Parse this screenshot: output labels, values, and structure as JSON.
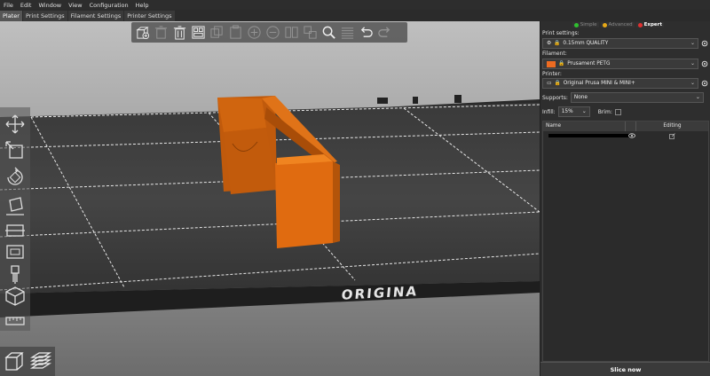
{
  "menu": [
    "File",
    "Edit",
    "Window",
    "View",
    "Configuration",
    "Help"
  ],
  "tabs": [
    "Plater",
    "Print Settings",
    "Filament Settings",
    "Printer Settings"
  ],
  "viewport": {
    "bed_text": "ORIGINA"
  },
  "top_toolbar": [
    {
      "icon": "add-icon",
      "enabled": true
    },
    {
      "icon": "delete-icon",
      "enabled": false
    },
    {
      "icon": "delete-all-icon",
      "enabled": true
    },
    {
      "icon": "arrange-icon",
      "enabled": true
    },
    {
      "icon": "copy-icon",
      "enabled": false
    },
    {
      "icon": "paste-icon",
      "enabled": false
    },
    {
      "icon": "instance-add-icon",
      "enabled": false
    },
    {
      "icon": "instance-remove-icon",
      "enabled": false
    },
    {
      "icon": "split-objects-icon",
      "enabled": false
    },
    {
      "icon": "split-parts-icon",
      "enabled": false
    },
    {
      "icon": "search-icon",
      "enabled": true
    },
    {
      "icon": "layer-editing-icon",
      "enabled": false
    },
    {
      "icon": "undo-icon",
      "enabled": true
    },
    {
      "icon": "redo-icon",
      "enabled": false
    }
  ],
  "left_toolbar": [
    "move-icon",
    "scale-icon",
    "rotate-icon",
    "place-on-face-icon",
    "cut-icon",
    "hollow-icon",
    "paint-supports-icon",
    "seam-painting-icon",
    "measure-icon"
  ],
  "sidebar": {
    "modes": [
      {
        "label": "Simple",
        "color": "#2fbf2f"
      },
      {
        "label": "Advanced",
        "color": "#e6a817"
      },
      {
        "label": "Expert",
        "color": "#e03030"
      }
    ],
    "print_settings_label": "Print settings:",
    "print_settings_value": "0.15mm QUALITY",
    "filament_label": "Filament:",
    "filament_value": "Prusament PETG",
    "filament_color": "#ed6b21",
    "printer_label": "Printer:",
    "printer_value": "Original Prusa MINI & MINI+",
    "supports_label": "Supports:",
    "supports_value": "None",
    "infill_label": "Infill:",
    "infill_value": "15%",
    "brim_label": "Brim:",
    "list_name_header": "Name",
    "list_editing_header": "Editing",
    "slice_button": "Slice now"
  }
}
